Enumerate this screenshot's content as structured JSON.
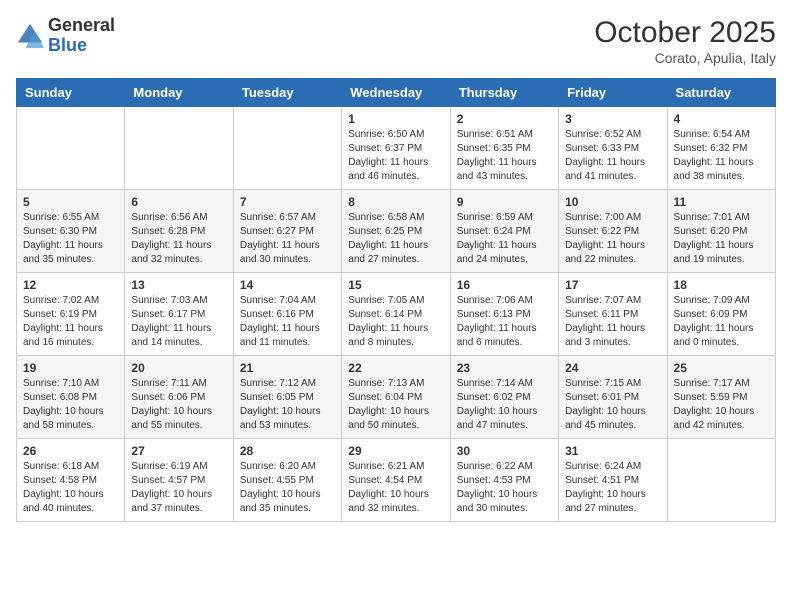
{
  "logo": {
    "general": "General",
    "blue": "Blue"
  },
  "header": {
    "month": "October 2025",
    "location": "Corato, Apulia, Italy"
  },
  "weekdays": [
    "Sunday",
    "Monday",
    "Tuesday",
    "Wednesday",
    "Thursday",
    "Friday",
    "Saturday"
  ],
  "weeks": [
    [
      {
        "day": "",
        "info": ""
      },
      {
        "day": "",
        "info": ""
      },
      {
        "day": "",
        "info": ""
      },
      {
        "day": "1",
        "info": "Sunrise: 6:50 AM\nSunset: 6:37 PM\nDaylight: 11 hours and 46 minutes."
      },
      {
        "day": "2",
        "info": "Sunrise: 6:51 AM\nSunset: 6:35 PM\nDaylight: 11 hours and 43 minutes."
      },
      {
        "day": "3",
        "info": "Sunrise: 6:52 AM\nSunset: 6:33 PM\nDaylight: 11 hours and 41 minutes."
      },
      {
        "day": "4",
        "info": "Sunrise: 6:54 AM\nSunset: 6:32 PM\nDaylight: 11 hours and 38 minutes."
      }
    ],
    [
      {
        "day": "5",
        "info": "Sunrise: 6:55 AM\nSunset: 6:30 PM\nDaylight: 11 hours and 35 minutes."
      },
      {
        "day": "6",
        "info": "Sunrise: 6:56 AM\nSunset: 6:28 PM\nDaylight: 11 hours and 32 minutes."
      },
      {
        "day": "7",
        "info": "Sunrise: 6:57 AM\nSunset: 6:27 PM\nDaylight: 11 hours and 30 minutes."
      },
      {
        "day": "8",
        "info": "Sunrise: 6:58 AM\nSunset: 6:25 PM\nDaylight: 11 hours and 27 minutes."
      },
      {
        "day": "9",
        "info": "Sunrise: 6:59 AM\nSunset: 6:24 PM\nDaylight: 11 hours and 24 minutes."
      },
      {
        "day": "10",
        "info": "Sunrise: 7:00 AM\nSunset: 6:22 PM\nDaylight: 11 hours and 22 minutes."
      },
      {
        "day": "11",
        "info": "Sunrise: 7:01 AM\nSunset: 6:20 PM\nDaylight: 11 hours and 19 minutes."
      }
    ],
    [
      {
        "day": "12",
        "info": "Sunrise: 7:02 AM\nSunset: 6:19 PM\nDaylight: 11 hours and 16 minutes."
      },
      {
        "day": "13",
        "info": "Sunrise: 7:03 AM\nSunset: 6:17 PM\nDaylight: 11 hours and 14 minutes."
      },
      {
        "day": "14",
        "info": "Sunrise: 7:04 AM\nSunset: 6:16 PM\nDaylight: 11 hours and 11 minutes."
      },
      {
        "day": "15",
        "info": "Sunrise: 7:05 AM\nSunset: 6:14 PM\nDaylight: 11 hours and 8 minutes."
      },
      {
        "day": "16",
        "info": "Sunrise: 7:06 AM\nSunset: 6:13 PM\nDaylight: 11 hours and 6 minutes."
      },
      {
        "day": "17",
        "info": "Sunrise: 7:07 AM\nSunset: 6:11 PM\nDaylight: 11 hours and 3 minutes."
      },
      {
        "day": "18",
        "info": "Sunrise: 7:09 AM\nSunset: 6:09 PM\nDaylight: 11 hours and 0 minutes."
      }
    ],
    [
      {
        "day": "19",
        "info": "Sunrise: 7:10 AM\nSunset: 6:08 PM\nDaylight: 10 hours and 58 minutes."
      },
      {
        "day": "20",
        "info": "Sunrise: 7:11 AM\nSunset: 6:06 PM\nDaylight: 10 hours and 55 minutes."
      },
      {
        "day": "21",
        "info": "Sunrise: 7:12 AM\nSunset: 6:05 PM\nDaylight: 10 hours and 53 minutes."
      },
      {
        "day": "22",
        "info": "Sunrise: 7:13 AM\nSunset: 6:04 PM\nDaylight: 10 hours and 50 minutes."
      },
      {
        "day": "23",
        "info": "Sunrise: 7:14 AM\nSunset: 6:02 PM\nDaylight: 10 hours and 47 minutes."
      },
      {
        "day": "24",
        "info": "Sunrise: 7:15 AM\nSunset: 6:01 PM\nDaylight: 10 hours and 45 minutes."
      },
      {
        "day": "25",
        "info": "Sunrise: 7:17 AM\nSunset: 5:59 PM\nDaylight: 10 hours and 42 minutes."
      }
    ],
    [
      {
        "day": "26",
        "info": "Sunrise: 6:18 AM\nSunset: 4:58 PM\nDaylight: 10 hours and 40 minutes."
      },
      {
        "day": "27",
        "info": "Sunrise: 6:19 AM\nSunset: 4:57 PM\nDaylight: 10 hours and 37 minutes."
      },
      {
        "day": "28",
        "info": "Sunrise: 6:20 AM\nSunset: 4:55 PM\nDaylight: 10 hours and 35 minutes."
      },
      {
        "day": "29",
        "info": "Sunrise: 6:21 AM\nSunset: 4:54 PM\nDaylight: 10 hours and 32 minutes."
      },
      {
        "day": "30",
        "info": "Sunrise: 6:22 AM\nSunset: 4:53 PM\nDaylight: 10 hours and 30 minutes."
      },
      {
        "day": "31",
        "info": "Sunrise: 6:24 AM\nSunset: 4:51 PM\nDaylight: 10 hours and 27 minutes."
      },
      {
        "day": "",
        "info": ""
      }
    ]
  ]
}
